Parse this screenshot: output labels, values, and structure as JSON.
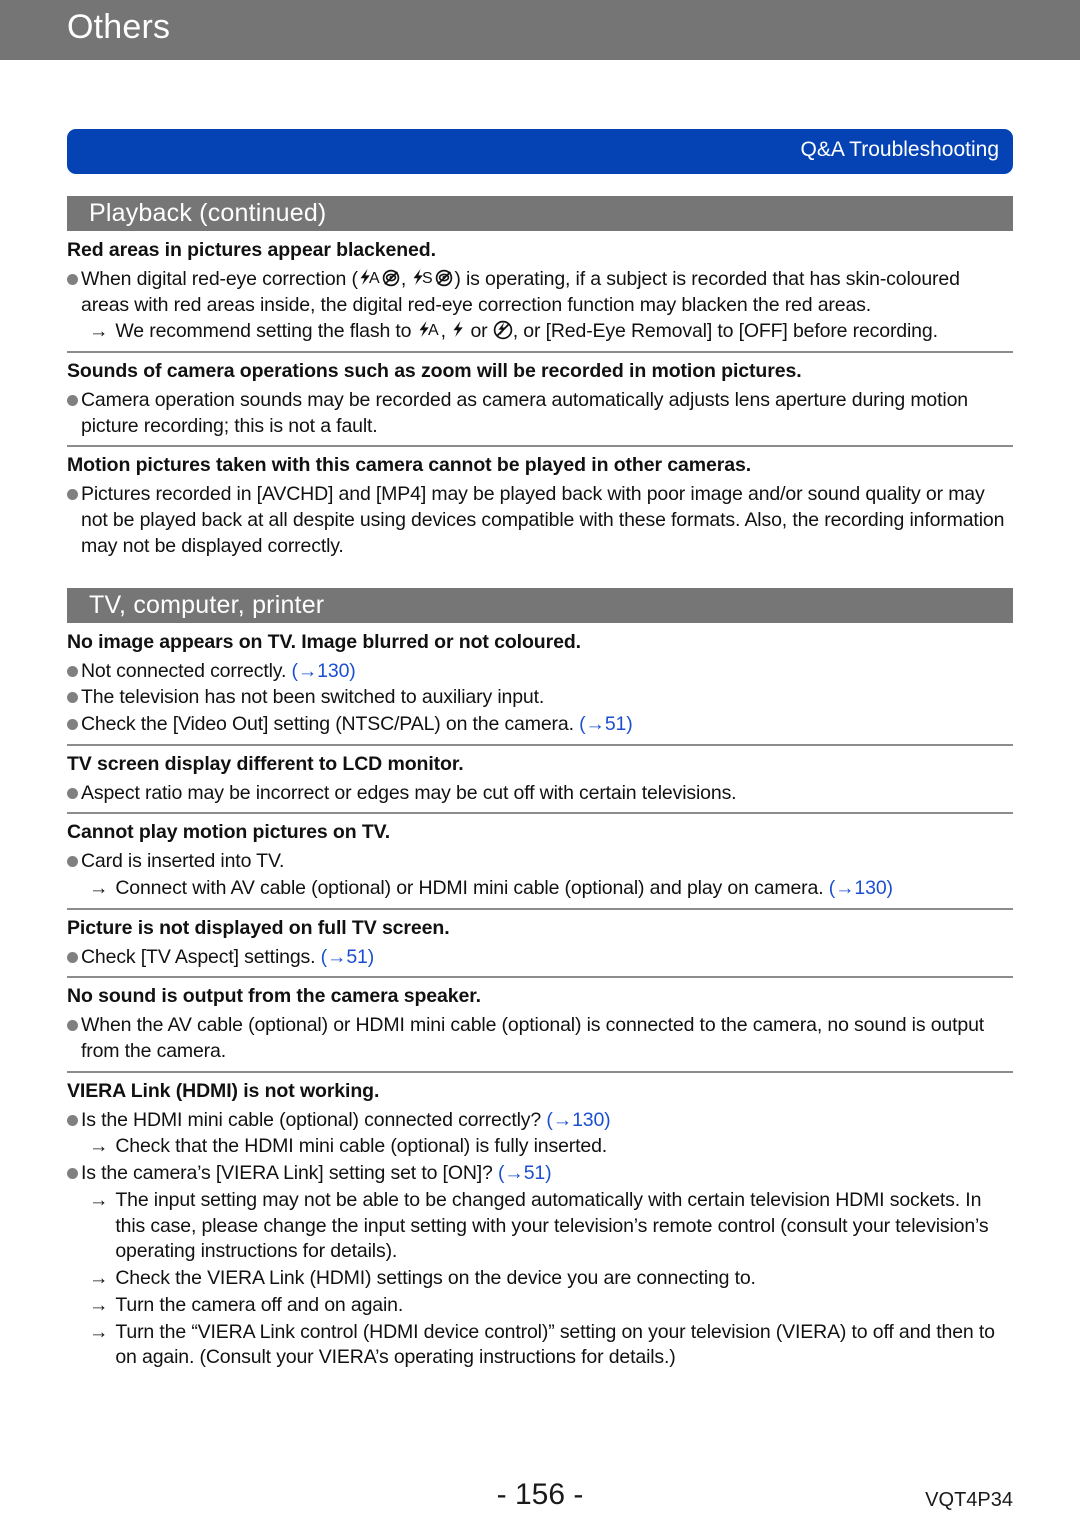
{
  "chapter": {
    "title": "Others",
    "bar_color": "#757575"
  },
  "qa_banner": {
    "label": "Q&A  Troubleshooting",
    "color": "#0543b5"
  },
  "link_color": "#1b4fd1",
  "sections": [
    {
      "title": "Playback (continued)",
      "blocks": [
        {
          "heading": "Red areas in pictures appear blackened.",
          "lines": [
            {
              "kind": "bullet",
              "parts": [
                {
                  "t": "text",
                  "v": "When digital red-eye correction ("
                },
                {
                  "t": "icon",
                  "v": "flash-auto-redeye-icon"
                },
                {
                  "t": "text",
                  "v": ", "
                },
                {
                  "t": "icon",
                  "v": "flash-slow-sync-redeye-icon"
                },
                {
                  "t": "text",
                  "v": ") is operating, if a subject is recorded that has skin-coloured areas with red areas inside, the digital red-eye correction function may blacken the red areas."
                }
              ]
            },
            {
              "kind": "arrow",
              "parts": [
                {
                  "t": "text",
                  "v": "We recommend setting the flash to "
                },
                {
                  "t": "icon",
                  "v": "flash-auto-icon"
                },
                {
                  "t": "text",
                  "v": ", "
                },
                {
                  "t": "icon",
                  "v": "flash-on-icon"
                },
                {
                  "t": "text",
                  "v": " or "
                },
                {
                  "t": "icon",
                  "v": "flash-off-icon"
                },
                {
                  "t": "text",
                  "v": ", or [Red-Eye Removal] to [OFF] before recording."
                }
              ]
            }
          ]
        },
        {
          "heading": "Sounds of camera operations such as zoom will be recorded in motion pictures.",
          "lines": [
            {
              "kind": "bullet",
              "parts": [
                {
                  "t": "text",
                  "v": "Camera operation sounds may be recorded as camera automatically adjusts lens aperture during motion picture recording; this is not a fault."
                }
              ]
            }
          ]
        },
        {
          "heading": "Motion pictures taken with this camera cannot be played in other cameras.",
          "lines": [
            {
              "kind": "bullet",
              "parts": [
                {
                  "t": "text",
                  "v": "Pictures recorded in [AVCHD] and [MP4] may be played back with poor image and/or sound quality or may not be played back at all despite using devices compatible with these formats. Also, the recording information may not be displayed correctly."
                }
              ]
            }
          ],
          "no_rule": true
        }
      ]
    },
    {
      "title": "TV, computer, printer",
      "blocks": [
        {
          "heading": "No image appears on TV. Image blurred or not coloured.",
          "lines": [
            {
              "kind": "bullet",
              "parts": [
                {
                  "t": "text",
                  "v": "Not connected correctly. "
                },
                {
                  "t": "ref",
                  "v": "(→130)"
                }
              ]
            },
            {
              "kind": "bullet",
              "parts": [
                {
                  "t": "text",
                  "v": "The television has not been switched to auxiliary input."
                }
              ]
            },
            {
              "kind": "bullet",
              "parts": [
                {
                  "t": "text",
                  "v": "Check the [Video Out] setting (NTSC/PAL) on the camera. "
                },
                {
                  "t": "ref",
                  "v": "(→51)"
                }
              ]
            }
          ]
        },
        {
          "heading": "TV screen display different to LCD monitor.",
          "lines": [
            {
              "kind": "bullet",
              "parts": [
                {
                  "t": "text",
                  "v": "Aspect ratio may be incorrect or edges may be cut off with certain televisions."
                }
              ]
            }
          ]
        },
        {
          "heading": "Cannot play motion pictures on TV.",
          "lines": [
            {
              "kind": "bullet",
              "parts": [
                {
                  "t": "text",
                  "v": "Card is inserted into TV."
                }
              ]
            },
            {
              "kind": "arrow",
              "parts": [
                {
                  "t": "text",
                  "v": "Connect with AV cable (optional) or HDMI mini cable (optional) and play on camera. "
                },
                {
                  "t": "ref",
                  "v": "(→130)"
                }
              ]
            }
          ]
        },
        {
          "heading": "Picture is not displayed on full TV screen.",
          "lines": [
            {
              "kind": "bullet",
              "parts": [
                {
                  "t": "text",
                  "v": "Check [TV Aspect] settings. "
                },
                {
                  "t": "ref",
                  "v": "(→51)"
                }
              ]
            }
          ]
        },
        {
          "heading": "No sound is output from the camera speaker.",
          "lines": [
            {
              "kind": "bullet",
              "parts": [
                {
                  "t": "text",
                  "v": "When the AV cable (optional) or HDMI mini cable (optional) is connected to the camera, no sound is output from the camera."
                }
              ]
            }
          ]
        },
        {
          "heading": "VIERA Link (HDMI) is not working.",
          "lines": [
            {
              "kind": "bullet",
              "parts": [
                {
                  "t": "text",
                  "v": "Is the HDMI mini cable (optional) connected correctly? "
                },
                {
                  "t": "ref",
                  "v": "(→130)"
                }
              ]
            },
            {
              "kind": "arrow",
              "parts": [
                {
                  "t": "text",
                  "v": "Check that the HDMI mini cable (optional) is fully inserted."
                }
              ]
            },
            {
              "kind": "bullet",
              "parts": [
                {
                  "t": "text",
                  "v": "Is the camera’s [VIERA Link] setting set to [ON]? "
                },
                {
                  "t": "ref",
                  "v": "(→51)"
                }
              ]
            },
            {
              "kind": "arrow",
              "parts": [
                {
                  "t": "text",
                  "v": "The input setting may not be able to be changed automatically with certain television HDMI sockets. In this case, please change the input setting with your television’s remote control (consult your television’s operating instructions for details)."
                }
              ]
            },
            {
              "kind": "arrow",
              "parts": [
                {
                  "t": "text",
                  "v": "Check the VIERA Link (HDMI) settings on the device you are connecting to."
                }
              ]
            },
            {
              "kind": "arrow",
              "parts": [
                {
                  "t": "text",
                  "v": "Turn the camera off and on again."
                }
              ]
            },
            {
              "kind": "arrow",
              "parts": [
                {
                  "t": "text",
                  "v": "Turn the “VIERA Link control (HDMI device control)” setting on your television (VIERA) to off and then to on again. (Consult your VIERA’s operating instructions for details.)"
                }
              ]
            }
          ],
          "no_rule": true
        }
      ]
    }
  ],
  "footer": {
    "page_number": "- 156 -",
    "doc_code": "VQT4P34"
  }
}
